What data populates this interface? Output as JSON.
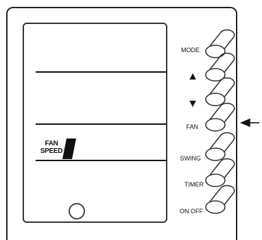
{
  "display": {
    "fan_speed_line1": "FAN",
    "fan_speed_line2": "SPEED"
  },
  "buttons": {
    "mode": "MODE",
    "up": "▲",
    "down": "▼",
    "fan": "FAN",
    "swing": "SWING",
    "timer": "TIMER",
    "onoff": "ON OFF"
  },
  "colors": {
    "stroke": "#222222",
    "background": "#ffffff"
  }
}
